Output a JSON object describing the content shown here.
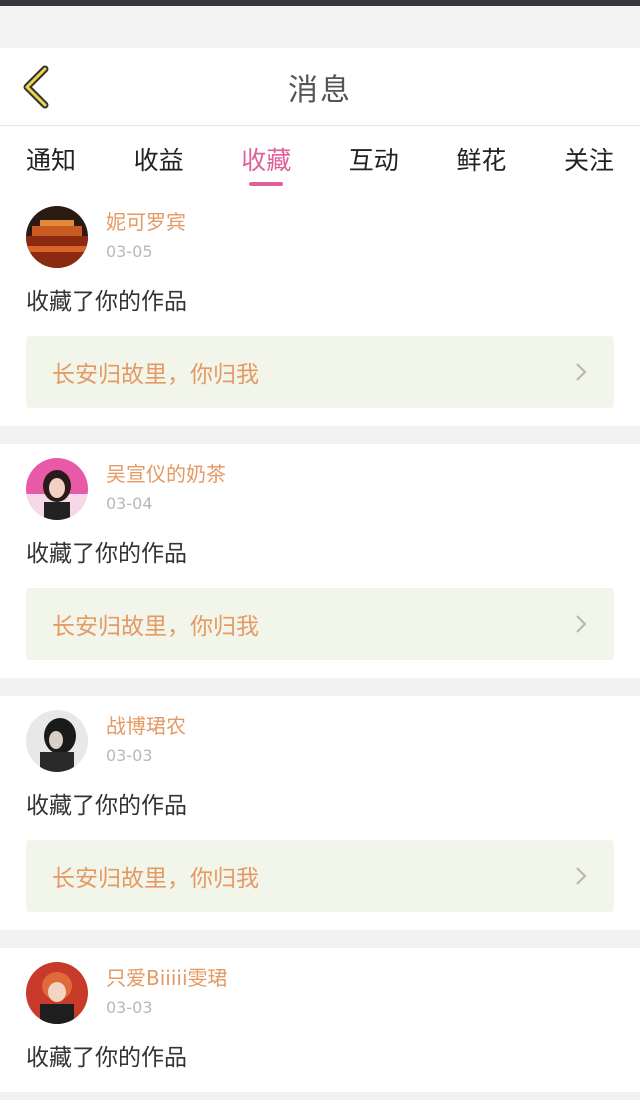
{
  "header": {
    "title": "消息",
    "back_icon": "chevron-left-icon"
  },
  "tabs": [
    {
      "label": "通知"
    },
    {
      "label": "收益"
    },
    {
      "label": "收藏",
      "active": true
    },
    {
      "label": "互动"
    },
    {
      "label": "鲜花"
    },
    {
      "label": "关注"
    }
  ],
  "colors": {
    "accent_pink": "#e0609a",
    "name_orange": "#e59a63",
    "card_tint": "#f2f5ea"
  },
  "items": [
    {
      "username": "妮可罗宾",
      "date": "03-05",
      "action": "收藏了你的作品",
      "work": "长安归故里，你归我"
    },
    {
      "username": "吴宣仪的奶茶",
      "date": "03-04",
      "action": "收藏了你的作品",
      "work": "长安归故里，你归我"
    },
    {
      "username": "战博珺农",
      "date": "03-03",
      "action": "收藏了你的作品",
      "work": "长安归故里，你归我"
    },
    {
      "username": "只爱Biiiii雯珺",
      "date": "03-03",
      "action": "收藏了你的作品"
    }
  ]
}
